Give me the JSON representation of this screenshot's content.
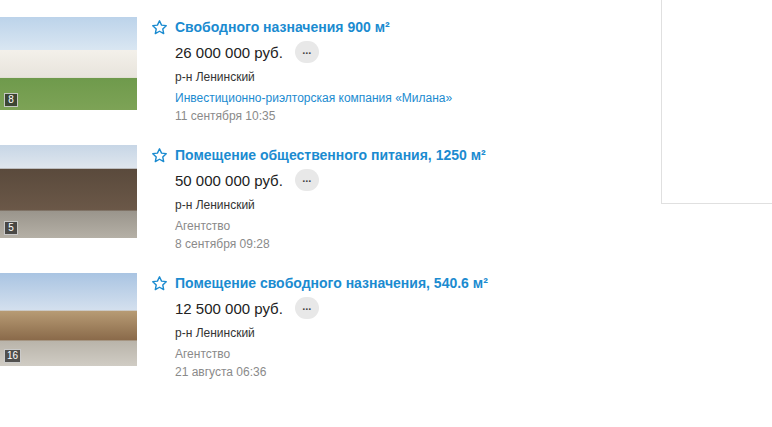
{
  "more_label": "...",
  "listings": [
    {
      "title": "Свободного назначения 900 м²",
      "price": "26 000 000 руб.",
      "district": "р-н Ленинский",
      "agency": "Инвестиционно-риэлторская компания «Милана»",
      "linked": true,
      "date": "11 сентября 10:35",
      "photos": "8",
      "starred": false
    },
    {
      "title": "Помещение общественного питания, 1250 м²",
      "price": "50 000 000 руб.",
      "district": "р-н Ленинский",
      "agency": "Агентство",
      "linked": false,
      "date": "8 сентября 09:28",
      "photos": "5",
      "starred": false
    },
    {
      "title": "Помещение свободного назначения, 540.6 м²",
      "price": "12 500 000 руб.",
      "district": "р-н Ленинский",
      "agency": "Агентство",
      "linked": false,
      "date": "21 августа 06:36",
      "photos": "16",
      "starred": false
    }
  ]
}
